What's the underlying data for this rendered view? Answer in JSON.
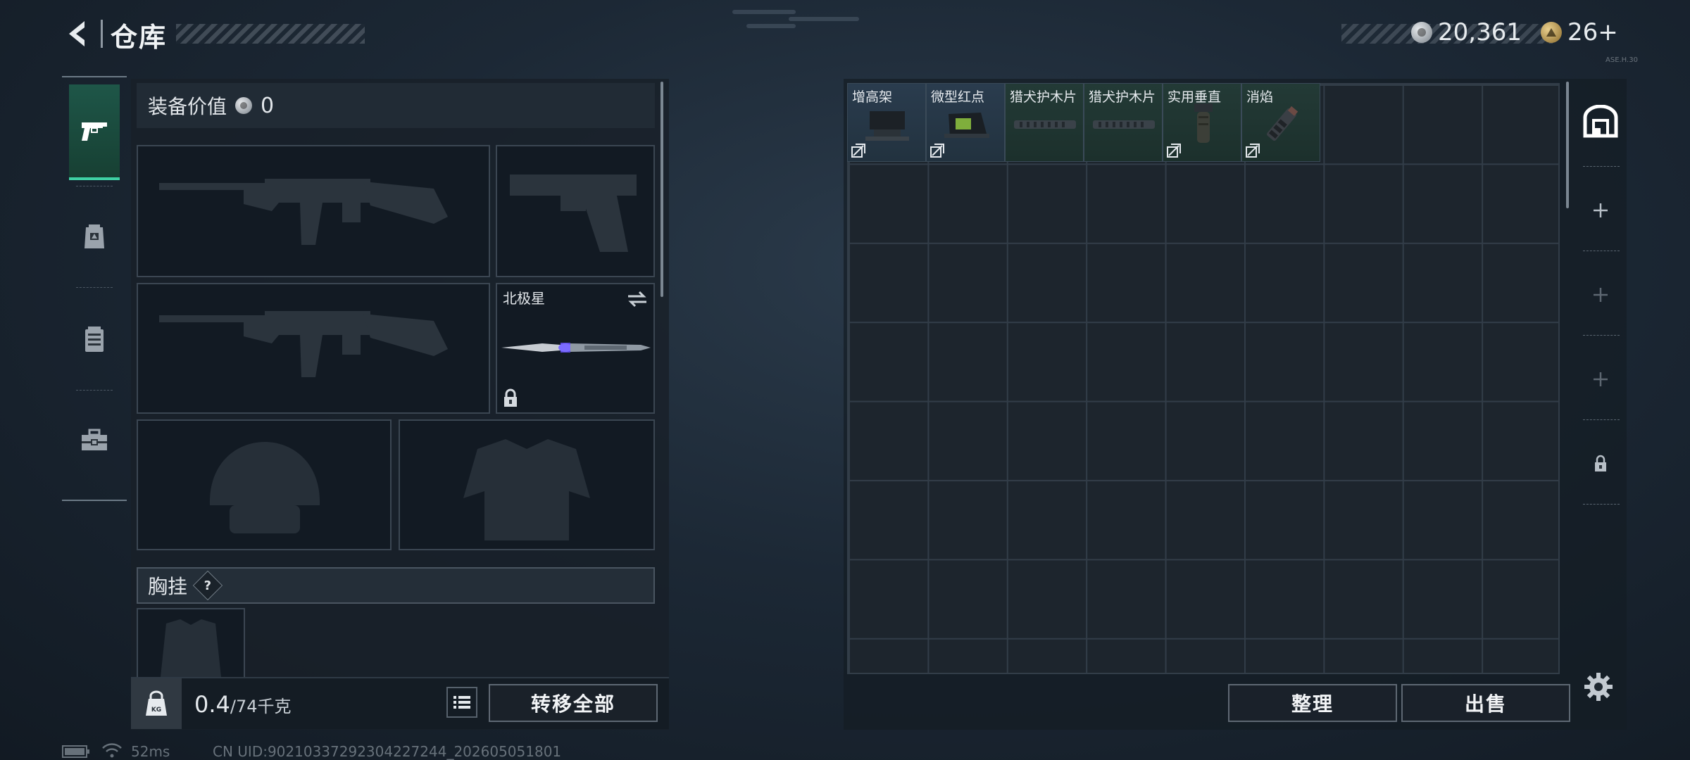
{
  "header": {
    "title": "仓库",
    "silver_amount": "20,361",
    "gold_amount": "26+",
    "corner_label": "ASE.H.30"
  },
  "left_tabs": [
    {
      "name": "weapons",
      "icon": "pistol-icon",
      "active": true
    },
    {
      "name": "gear",
      "icon": "backpack-icon",
      "active": false
    },
    {
      "name": "vest",
      "icon": "rig-icon",
      "active": false
    },
    {
      "name": "toolbox",
      "icon": "toolbox-icon",
      "active": false
    }
  ],
  "equipment": {
    "value_label": "装备价值",
    "value": "0",
    "melee_name": "北极星",
    "chest_label": "胸挂",
    "help": "?"
  },
  "weight": {
    "current": "0.4",
    "capacity": "/74",
    "unit": "千克",
    "kg_badge": "KG"
  },
  "buttons": {
    "transfer_all": "转移全部",
    "sort": "整理",
    "sell": "出售"
  },
  "stash_items": [
    {
      "name": "增高架",
      "style": "blue",
      "flag": true
    },
    {
      "name": "微型红点",
      "style": "blue",
      "flag": true
    },
    {
      "name": "猎犬护木片",
      "style": "green",
      "flag": false
    },
    {
      "name": "猎犬护木片",
      "style": "green",
      "flag": false
    },
    {
      "name": "实用垂直",
      "style": "green",
      "flag": true
    },
    {
      "name": "消焰",
      "style": "green",
      "flag": true
    }
  ],
  "status_bar": {
    "ping": "52ms",
    "uid": "CN UID:90210337292304227244_202605051801"
  },
  "colors": {
    "accent_green": "#3fd1a4",
    "item_blue": "#2a3c4e",
    "item_green": "#233a36"
  }
}
